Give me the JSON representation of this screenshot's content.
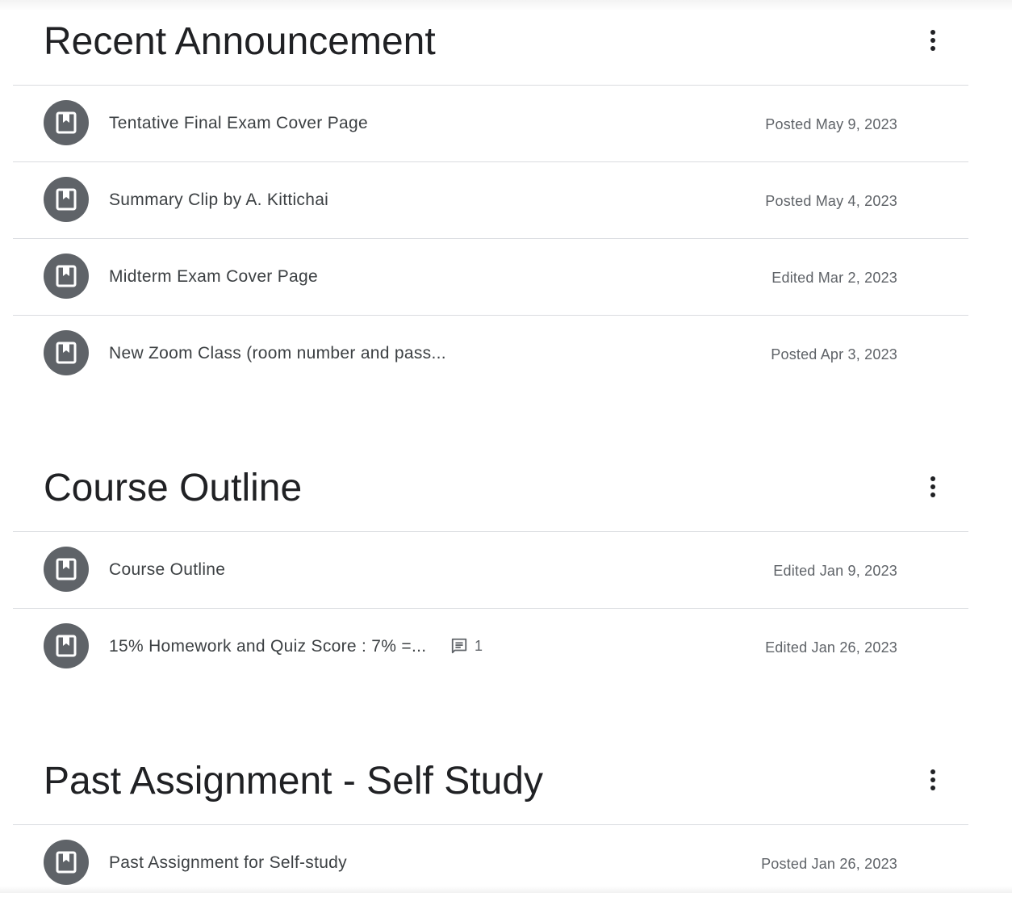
{
  "sections": [
    {
      "title": "Recent Announcement",
      "menu_icon": "more-vert-icon",
      "items": [
        {
          "title": "Tentative Final Exam Cover Page",
          "date": "Posted May 9, 2023",
          "icon": "material-icon"
        },
        {
          "title": "Summary Clip by A. Kittichai",
          "date": "Posted May 4, 2023",
          "icon": "material-icon"
        },
        {
          "title": "Midterm Exam Cover Page",
          "date": "Edited Mar 2, 2023",
          "icon": "material-icon"
        },
        {
          "title": "New Zoom Class (room number and pass...",
          "date": "Posted Apr 3, 2023",
          "icon": "material-icon"
        }
      ]
    },
    {
      "title": "Course Outline",
      "menu_icon": "more-vert-icon",
      "items": [
        {
          "title": "Course Outline",
          "date": "Edited Jan 9, 2023",
          "icon": "material-icon"
        },
        {
          "title": "15% Homework and Quiz Score : 7% =...",
          "date": "Edited Jan 26, 2023",
          "icon": "material-icon",
          "comment_icon": "comment-icon",
          "comment_count": "1"
        }
      ]
    },
    {
      "title": "Past Assignment - Self Study",
      "menu_icon": "more-vert-icon",
      "items": [
        {
          "title": "Past Assignment for Self-study",
          "date": "Posted Jan 26, 2023",
          "icon": "material-icon"
        }
      ]
    }
  ],
  "colors": {
    "avatar_bg": "#5f6368",
    "title_text": "#202124",
    "item_text": "#3c4043",
    "date_text": "#5f6368",
    "divider": "#dadce0"
  }
}
